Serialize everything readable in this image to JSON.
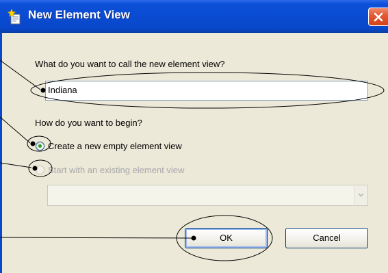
{
  "window": {
    "title": "New Element View"
  },
  "form": {
    "name_prompt": "What do you want to call the new element view?",
    "name_value": "Indiana",
    "begin_prompt": "How do you want to begin?",
    "option_new": "Create a new empty element view",
    "option_existing": "Start with an existing element view",
    "option_new_selected": true,
    "option_existing_enabled": false,
    "existing_view_value": ""
  },
  "buttons": {
    "ok": "OK",
    "cancel": "Cancel"
  },
  "colors": {
    "titlebar": "#0a4bd2",
    "dialog_bg": "#ece9d8",
    "close_button": "#e35a36",
    "radio_dot": "#21a121"
  }
}
